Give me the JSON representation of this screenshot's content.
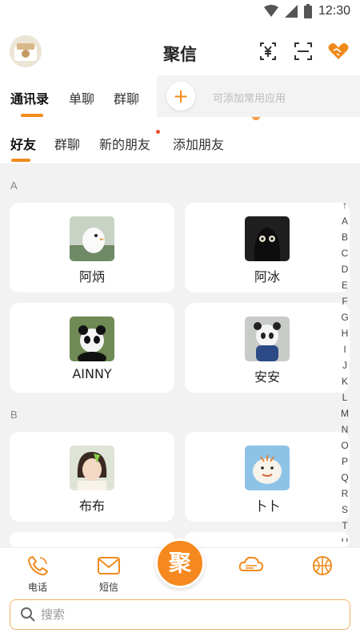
{
  "status_bar": {
    "time": "12:30",
    "icons": [
      "wifi-icon",
      "signal-icon",
      "battery-icon"
    ]
  },
  "header": {
    "title": "聚信",
    "icons": [
      "yuan-receipt-icon",
      "scan-icon",
      "handshake-heart-icon"
    ]
  },
  "tabs": [
    {
      "label": "通讯录",
      "active": true
    },
    {
      "label": "单聊",
      "active": false
    },
    {
      "label": "群聊",
      "active": false
    }
  ],
  "add_panel": {
    "button": "+",
    "hint": "可添加常用应用"
  },
  "subtabs": [
    {
      "label": "好友",
      "active": true
    },
    {
      "label": "群聊",
      "active": false
    },
    {
      "label": "新的朋友",
      "active": false,
      "badge_dot": true
    },
    {
      "label": "添加朋友",
      "active": false
    }
  ],
  "sections": [
    {
      "letter": "A",
      "contacts": [
        {
          "name": "阿炳"
        },
        {
          "name": "阿冰"
        },
        {
          "name": "AINNY"
        },
        {
          "name": "安安"
        }
      ]
    },
    {
      "letter": "B",
      "contacts": [
        {
          "name": "布布"
        },
        {
          "name": "卜卜"
        }
      ]
    }
  ],
  "alpha_index": [
    "↑",
    "A",
    "B",
    "C",
    "D",
    "E",
    "F",
    "G",
    "H",
    "I",
    "J",
    "K",
    "L",
    "M",
    "N",
    "O",
    "P",
    "Q",
    "R",
    "S",
    "T",
    "U"
  ],
  "bottom_nav": [
    {
      "label": "电话",
      "icon": "phone-icon"
    },
    {
      "label": "短信",
      "icon": "mail-icon"
    },
    {
      "label": "聚",
      "icon": "center-logo"
    },
    {
      "label": "",
      "icon": "cloud-chat-icon"
    },
    {
      "label": "",
      "icon": "basketball-icon"
    }
  ],
  "search": {
    "placeholder": "搜索",
    "value": ""
  },
  "colors": {
    "accent": "#f08a1c",
    "background": "#f2f2f2",
    "card": "#ffffff"
  }
}
